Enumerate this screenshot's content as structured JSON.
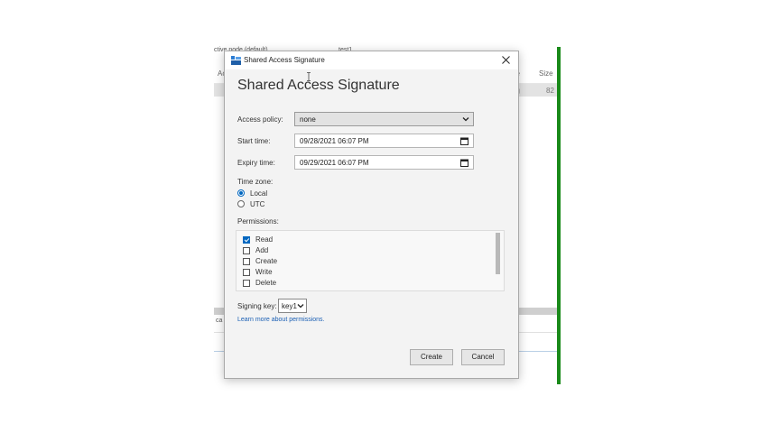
{
  "background": {
    "top_left_text": "ctive node (default)",
    "top_right_text": "test1",
    "col_acc": "Ac",
    "col_type": "pe",
    "col_size": "Size",
    "row_type": "ng",
    "row_size": "82",
    "status_text": "ca",
    "accent_color": "#1a8a1a"
  },
  "dialog": {
    "title": "Shared Access Signature",
    "heading": "Shared Access Signature",
    "close_icon": "close-icon",
    "access_policy": {
      "label": "Access policy:",
      "value": "none"
    },
    "start_time": {
      "label": "Start time:",
      "value": "09/28/2021 06:07 PM"
    },
    "expiry_time": {
      "label": "Expiry time:",
      "value": "09/29/2021 06:07 PM"
    },
    "time_zone": {
      "label": "Time zone:",
      "options": [
        {
          "label": "Local",
          "selected": true
        },
        {
          "label": "UTC",
          "selected": false
        }
      ]
    },
    "permissions": {
      "label": "Permissions:",
      "items": [
        {
          "label": "Read",
          "checked": true
        },
        {
          "label": "Add",
          "checked": false
        },
        {
          "label": "Create",
          "checked": false
        },
        {
          "label": "Write",
          "checked": false
        },
        {
          "label": "Delete",
          "checked": false
        }
      ]
    },
    "signing_key": {
      "label": "Signing key:",
      "value": "key1"
    },
    "learn_more": "Learn more about permissions.",
    "create_label": "Create",
    "cancel_label": "Cancel"
  }
}
